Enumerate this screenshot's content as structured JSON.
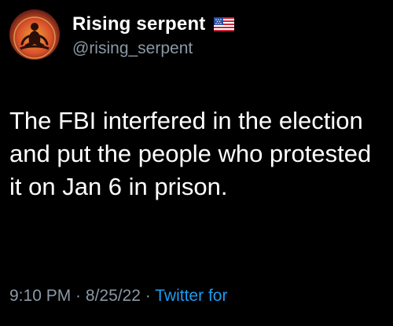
{
  "tweet": {
    "author": {
      "display_name": "Rising serpent",
      "handle": "@rising_serpent",
      "flag_icon": "us-flag-icon",
      "avatar_icon": "meditating-figure-icon"
    },
    "text": "The FBI interfered in the election and put the people who protested it on Jan 6 in prison.",
    "meta": {
      "time": "9:10 PM",
      "separator": " · ",
      "date": "8/25/22",
      "source": "Twitter for"
    }
  },
  "colors": {
    "background": "#000000",
    "primary_text": "#ffffff",
    "secondary_text": "#8b98a5",
    "link": "#1d9bf0"
  }
}
